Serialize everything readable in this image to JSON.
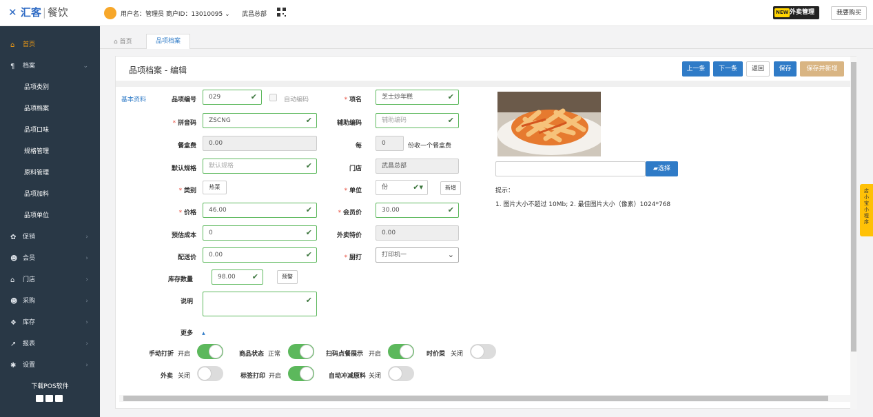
{
  "header": {
    "logo_main": "汇客",
    "logo_sep": "|",
    "logo_sub": "餐饮",
    "user_info": "用户名：管理员  商户ID：13010095 ⌄",
    "store": "武昌总部",
    "new_badge": "NEW",
    "takeout_label": "外卖管理",
    "buy_label": "我要购买"
  },
  "sidebar": {
    "home": "首页",
    "archive": "档案",
    "sub_items": [
      "品项类别",
      "品项档案",
      "品项口味",
      "规格管理",
      "原料管理",
      "品项加料",
      "品项单位"
    ],
    "items": [
      "促销",
      "会员",
      "门店",
      "采购",
      "库存",
      "报表",
      "设置"
    ],
    "download": "下载POS软件"
  },
  "tabs": {
    "home": "首页",
    "active": "品项档案"
  },
  "panel": {
    "title": "品项档案 - 编辑",
    "buttons": {
      "prev": "上一条",
      "next": "下一条",
      "back": "返回",
      "save": "保存",
      "save_new": "保存并新增"
    }
  },
  "form": {
    "section": "基本资料",
    "item_no_label": "品项编号",
    "item_no": "029",
    "auto_code": "自动编码",
    "name_label": "项名",
    "name": "芝士炒年糕",
    "pinyin_label": "拼音码",
    "pinyin": "ZSCNG",
    "aux_label": "辅助编码",
    "aux_ph": "辅助编码",
    "box_fee_label": "餐盒费",
    "box_fee": "0.00",
    "per_label": "每",
    "per_value": "0",
    "per_suffix": "份收一个餐盒费",
    "default_spec_label": "默认规格",
    "default_spec_ph": "默认规格",
    "store_label": "门店",
    "store_value": "武昌总部",
    "category_label": "类别",
    "category_value": "热菜",
    "unit_label": "单位",
    "unit_value": "份",
    "add_btn": "新增",
    "price_label": "价格",
    "price": "46.00",
    "member_price_label": "会员价",
    "member_price": "30.00",
    "est_cost_label": "预估成本",
    "est_cost": "0",
    "takeout_price_label": "外卖特价",
    "takeout_price": "0.00",
    "delivery_label": "配送价",
    "delivery": "0.00",
    "kitchen_label": "厨打",
    "kitchen_value": "打印机一",
    "stock_label": "库存数量",
    "stock": "98.00",
    "warn_btn": "预警",
    "desc_label": "说明",
    "more_label": "更多",
    "upload_btn": "选择",
    "tip_title": "提示：",
    "tip_text": "1. 图片大小不超过 10Mb; 2. 最佳图片大小（像素）1024*768"
  },
  "toggles": [
    {
      "label": "手动打折",
      "state": "开启",
      "on": true
    },
    {
      "label": "商品状态",
      "state": "正常",
      "on": true
    },
    {
      "label": "扫码点餐展示",
      "state": "开启",
      "on": true
    },
    {
      "label": "时价菜",
      "state": "关闭",
      "on": false
    },
    {
      "label": "外卖",
      "state": "关闭",
      "on": false
    },
    {
      "label": "标签打印",
      "state": "开启",
      "on": true
    },
    {
      "label": "自动冲减原料",
      "state": "关闭",
      "on": false
    }
  ],
  "float_tab": "店小宝小程序",
  "colors": {
    "sidebar": "#293846",
    "accent": "#2f7bc7",
    "valid": "#5cb85c",
    "active_nav": "#f39c12"
  }
}
